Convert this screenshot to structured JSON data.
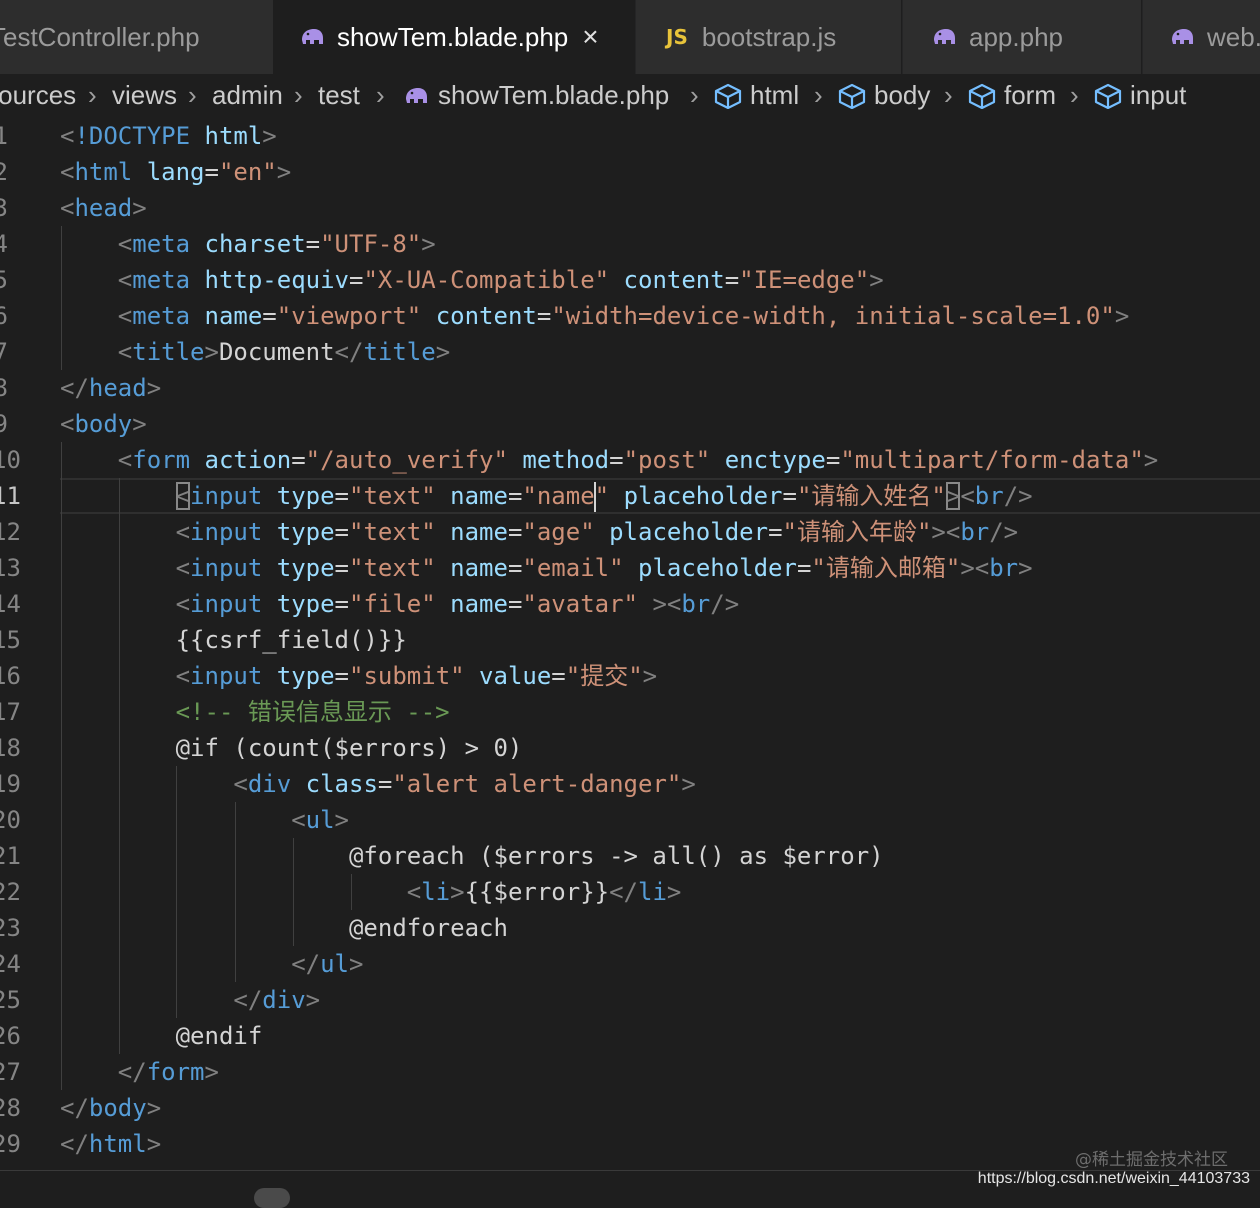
{
  "tabs": [
    {
      "label": "TestController.php",
      "icon": "php-elephant-icon"
    },
    {
      "label": "showTem.blade.php",
      "icon": "php-elephant-icon",
      "active": true,
      "close": "×"
    },
    {
      "label": "bootstrap.js",
      "icon": "JS"
    },
    {
      "label": "app.php",
      "icon": "php-elephant-icon"
    },
    {
      "label": "web.php",
      "icon": "php-elephant-icon"
    }
  ],
  "breadcrumb": [
    {
      "label": "resources"
    },
    {
      "label": "views"
    },
    {
      "label": "admin"
    },
    {
      "label": "test"
    },
    {
      "label": "showTem.blade.php",
      "icon": "php-elephant-icon"
    },
    {
      "label": "html",
      "icon": "cube-icon"
    },
    {
      "label": "body",
      "icon": "cube-icon"
    },
    {
      "label": "form",
      "icon": "cube-icon"
    },
    {
      "label": "input",
      "icon": "cube-icon"
    }
  ],
  "breadcrumb_separator": "›",
  "editor": {
    "current_line": 11,
    "lines": [
      {
        "n": "1",
        "tokens": [
          [
            "p",
            "<"
          ],
          [
            "t",
            "!DOCTYPE"
          ],
          [
            "d",
            " "
          ],
          [
            "a",
            "html"
          ],
          [
            "p",
            ">"
          ]
        ]
      },
      {
        "n": "2",
        "tokens": [
          [
            "p",
            "<"
          ],
          [
            "t",
            "html"
          ],
          [
            "d",
            " "
          ],
          [
            "a",
            "lang"
          ],
          [
            "d",
            "="
          ],
          [
            "s",
            "\"en\""
          ],
          [
            "p",
            ">"
          ]
        ]
      },
      {
        "n": "3",
        "tokens": [
          [
            "p",
            "<"
          ],
          [
            "t",
            "head"
          ],
          [
            "p",
            ">"
          ]
        ]
      },
      {
        "n": "4",
        "tokens": [
          [
            "d",
            "    "
          ],
          [
            "p",
            "<"
          ],
          [
            "t",
            "meta"
          ],
          [
            "d",
            " "
          ],
          [
            "a",
            "charset"
          ],
          [
            "d",
            "="
          ],
          [
            "s",
            "\"UTF-8\""
          ],
          [
            "p",
            ">"
          ]
        ]
      },
      {
        "n": "5",
        "tokens": [
          [
            "d",
            "    "
          ],
          [
            "p",
            "<"
          ],
          [
            "t",
            "meta"
          ],
          [
            "d",
            " "
          ],
          [
            "a",
            "http-equiv"
          ],
          [
            "d",
            "="
          ],
          [
            "s",
            "\"X-UA-Compatible\""
          ],
          [
            "d",
            " "
          ],
          [
            "a",
            "content"
          ],
          [
            "d",
            "="
          ],
          [
            "s",
            "\"IE=edge\""
          ],
          [
            "p",
            ">"
          ]
        ]
      },
      {
        "n": "6",
        "tokens": [
          [
            "d",
            "    "
          ],
          [
            "p",
            "<"
          ],
          [
            "t",
            "meta"
          ],
          [
            "d",
            " "
          ],
          [
            "a",
            "name"
          ],
          [
            "d",
            "="
          ],
          [
            "s",
            "\"viewport\""
          ],
          [
            "d",
            " "
          ],
          [
            "a",
            "content"
          ],
          [
            "d",
            "="
          ],
          [
            "s",
            "\"width=device-width, initial-scale=1.0\""
          ],
          [
            "p",
            ">"
          ]
        ]
      },
      {
        "n": "7",
        "tokens": [
          [
            "d",
            "    "
          ],
          [
            "p",
            "<"
          ],
          [
            "t",
            "title"
          ],
          [
            "p",
            ">"
          ],
          [
            "d",
            "Document"
          ],
          [
            "p",
            "</"
          ],
          [
            "t",
            "title"
          ],
          [
            "p",
            ">"
          ]
        ]
      },
      {
        "n": "8",
        "tokens": [
          [
            "p",
            "</"
          ],
          [
            "t",
            "head"
          ],
          [
            "p",
            ">"
          ]
        ]
      },
      {
        "n": "9",
        "tokens": [
          [
            "p",
            "<"
          ],
          [
            "t",
            "body"
          ],
          [
            "p",
            ">"
          ]
        ]
      },
      {
        "n": "10",
        "tokens": [
          [
            "d",
            "    "
          ],
          [
            "p",
            "<"
          ],
          [
            "t",
            "form"
          ],
          [
            "d",
            " "
          ],
          [
            "a",
            "action"
          ],
          [
            "d",
            "="
          ],
          [
            "s",
            "\"/auto_verify\""
          ],
          [
            "d",
            " "
          ],
          [
            "a",
            "method"
          ],
          [
            "d",
            "="
          ],
          [
            "s",
            "\"post\""
          ],
          [
            "d",
            " "
          ],
          [
            "a",
            "enctype"
          ],
          [
            "d",
            "="
          ],
          [
            "s",
            "\"multipart/form-data\""
          ],
          [
            "p",
            ">"
          ]
        ]
      },
      {
        "n": "11",
        "tokens": [
          [
            "d",
            "        "
          ],
          [
            "p bm",
            "<"
          ],
          [
            "t",
            "input"
          ],
          [
            "d",
            " "
          ],
          [
            "a",
            "type"
          ],
          [
            "d",
            "="
          ],
          [
            "s",
            "\"text\""
          ],
          [
            "d",
            " "
          ],
          [
            "a",
            "name"
          ],
          [
            "d",
            "="
          ],
          [
            "s",
            "\"name"
          ],
          [
            "caret",
            ""
          ],
          [
            "s",
            "\""
          ],
          [
            "d",
            " "
          ],
          [
            "a",
            "placeholder"
          ],
          [
            "d",
            "="
          ],
          [
            "s",
            "\"请输入姓名\""
          ],
          [
            "p bm",
            ">"
          ],
          [
            "p",
            "<"
          ],
          [
            "t",
            "br"
          ],
          [
            "p",
            "/>"
          ]
        ]
      },
      {
        "n": "12",
        "tokens": [
          [
            "d",
            "        "
          ],
          [
            "p",
            "<"
          ],
          [
            "t",
            "input"
          ],
          [
            "d",
            " "
          ],
          [
            "a",
            "type"
          ],
          [
            "d",
            "="
          ],
          [
            "s",
            "\"text\""
          ],
          [
            "d",
            " "
          ],
          [
            "a",
            "name"
          ],
          [
            "d",
            "="
          ],
          [
            "s",
            "\"age\""
          ],
          [
            "d",
            " "
          ],
          [
            "a",
            "placeholder"
          ],
          [
            "d",
            "="
          ],
          [
            "s",
            "\"请输入年龄\""
          ],
          [
            "p",
            ">"
          ],
          [
            "p",
            "<"
          ],
          [
            "t",
            "br"
          ],
          [
            "p",
            "/>"
          ]
        ]
      },
      {
        "n": "13",
        "tokens": [
          [
            "d",
            "        "
          ],
          [
            "p",
            "<"
          ],
          [
            "t",
            "input"
          ],
          [
            "d",
            " "
          ],
          [
            "a",
            "type"
          ],
          [
            "d",
            "="
          ],
          [
            "s",
            "\"text\""
          ],
          [
            "d",
            " "
          ],
          [
            "a",
            "name"
          ],
          [
            "d",
            "="
          ],
          [
            "s",
            "\"email\""
          ],
          [
            "d",
            " "
          ],
          [
            "a",
            "placeholder"
          ],
          [
            "d",
            "="
          ],
          [
            "s",
            "\"请输入邮箱\""
          ],
          [
            "p",
            ">"
          ],
          [
            "p",
            "<"
          ],
          [
            "t",
            "br"
          ],
          [
            "p",
            ">"
          ]
        ]
      },
      {
        "n": "14",
        "tokens": [
          [
            "d",
            "        "
          ],
          [
            "p",
            "<"
          ],
          [
            "t",
            "input"
          ],
          [
            "d",
            " "
          ],
          [
            "a",
            "type"
          ],
          [
            "d",
            "="
          ],
          [
            "s",
            "\"file\""
          ],
          [
            "d",
            " "
          ],
          [
            "a",
            "name"
          ],
          [
            "d",
            "="
          ],
          [
            "s",
            "\"avatar\""
          ],
          [
            "d",
            " "
          ],
          [
            "p",
            ">"
          ],
          [
            "p",
            "<"
          ],
          [
            "t",
            "br"
          ],
          [
            "p",
            "/>"
          ]
        ]
      },
      {
        "n": "15",
        "tokens": [
          [
            "d",
            "        {{csrf_field()}}"
          ]
        ]
      },
      {
        "n": "16",
        "tokens": [
          [
            "d",
            "        "
          ],
          [
            "p",
            "<"
          ],
          [
            "t",
            "input"
          ],
          [
            "d",
            " "
          ],
          [
            "a",
            "type"
          ],
          [
            "d",
            "="
          ],
          [
            "s",
            "\"submit\""
          ],
          [
            "d",
            " "
          ],
          [
            "a",
            "value"
          ],
          [
            "d",
            "="
          ],
          [
            "s",
            "\"提交\""
          ],
          [
            "p",
            ">"
          ]
        ]
      },
      {
        "n": "17",
        "tokens": [
          [
            "d",
            "        "
          ],
          [
            "c",
            "<!-- 错误信息显示 -->"
          ]
        ]
      },
      {
        "n": "18",
        "tokens": [
          [
            "d",
            "        @if (count($errors) > 0)"
          ]
        ]
      },
      {
        "n": "19",
        "tokens": [
          [
            "d",
            "            "
          ],
          [
            "p",
            "<"
          ],
          [
            "t",
            "div"
          ],
          [
            "d",
            " "
          ],
          [
            "a",
            "class"
          ],
          [
            "d",
            "="
          ],
          [
            "s",
            "\"alert alert-danger\""
          ],
          [
            "p",
            ">"
          ]
        ]
      },
      {
        "n": "20",
        "tokens": [
          [
            "d",
            "                "
          ],
          [
            "p",
            "<"
          ],
          [
            "t",
            "ul"
          ],
          [
            "p",
            ">"
          ]
        ]
      },
      {
        "n": "21",
        "tokens": [
          [
            "d",
            "                    @foreach ($errors -> all() as $error)"
          ]
        ]
      },
      {
        "n": "22",
        "tokens": [
          [
            "d",
            "                        "
          ],
          [
            "p",
            "<"
          ],
          [
            "t",
            "li"
          ],
          [
            "p",
            ">"
          ],
          [
            "d",
            "{{$error}}"
          ],
          [
            "p",
            "</"
          ],
          [
            "t",
            "li"
          ],
          [
            "p",
            ">"
          ]
        ]
      },
      {
        "n": "23",
        "tokens": [
          [
            "d",
            "                    @endforeach"
          ]
        ]
      },
      {
        "n": "24",
        "tokens": [
          [
            "d",
            "                "
          ],
          [
            "p",
            "</"
          ],
          [
            "t",
            "ul"
          ],
          [
            "p",
            ">"
          ]
        ]
      },
      {
        "n": "25",
        "tokens": [
          [
            "d",
            "            "
          ],
          [
            "p",
            "</"
          ],
          [
            "t",
            "div"
          ],
          [
            "p",
            ">"
          ]
        ]
      },
      {
        "n": "26",
        "tokens": [
          [
            "d",
            "        @endif"
          ]
        ]
      },
      {
        "n": "27",
        "tokens": [
          [
            "d",
            "    "
          ],
          [
            "p",
            "</"
          ],
          [
            "t",
            "form"
          ],
          [
            "p",
            ">"
          ]
        ]
      },
      {
        "n": "28",
        "tokens": [
          [
            "p",
            "</"
          ],
          [
            "t",
            "body"
          ],
          [
            "p",
            ">"
          ]
        ]
      },
      {
        "n": "29",
        "tokens": [
          [
            "p",
            "</"
          ],
          [
            "t",
            "html"
          ],
          [
            "p",
            ">"
          ]
        ]
      }
    ]
  },
  "watermark": {
    "site": "@稀土掘金技术社区",
    "url": "https://blog.csdn.net/weixin_44103733"
  }
}
